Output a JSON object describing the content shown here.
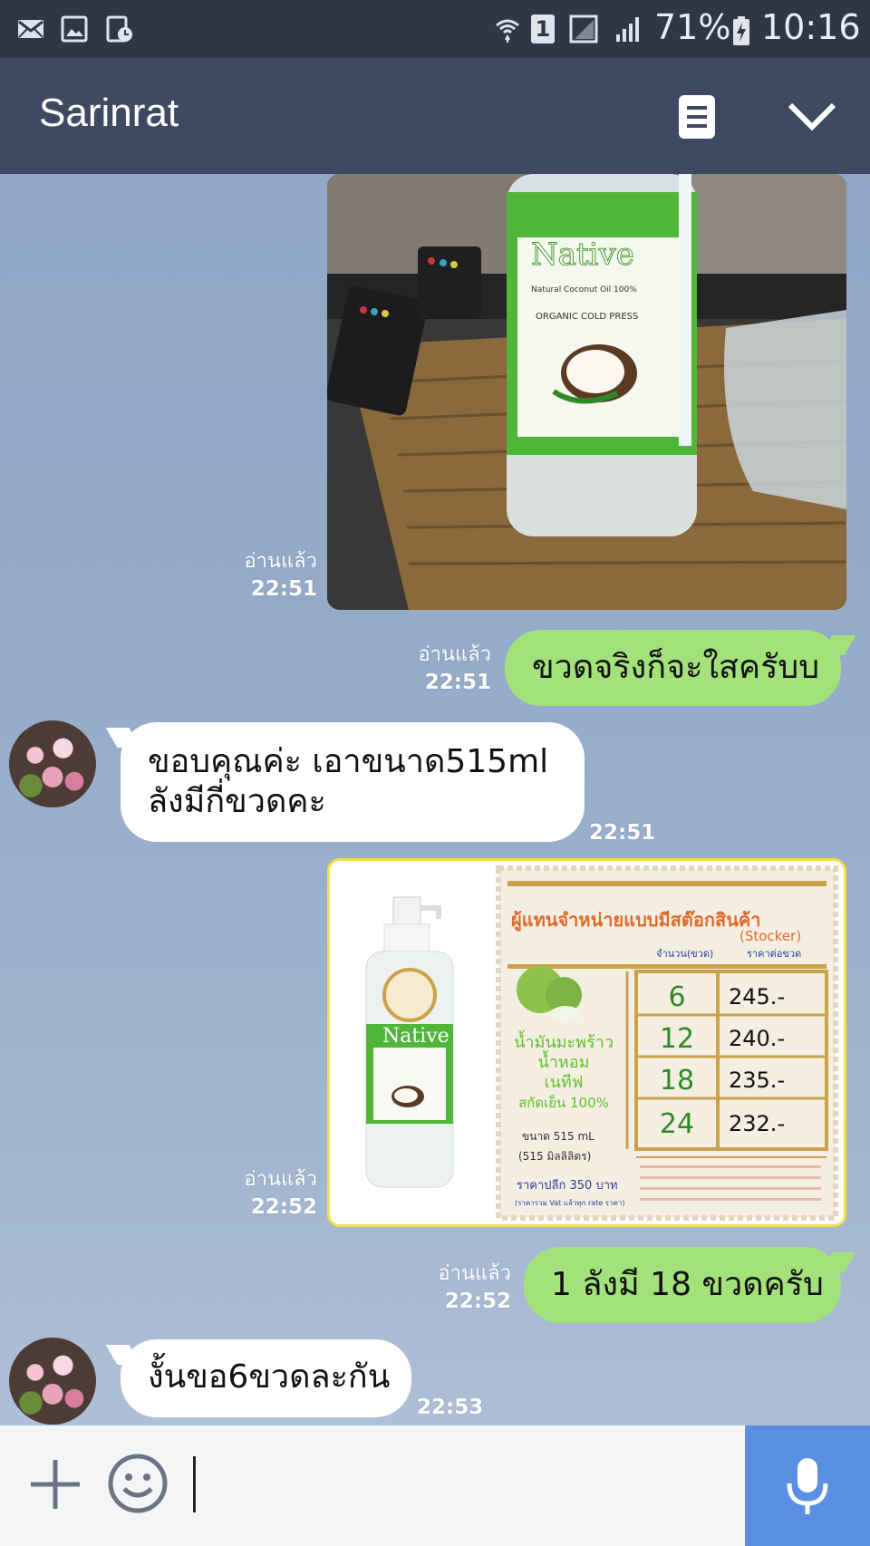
{
  "status_bar": {
    "battery": "71%",
    "signal_badge": "1",
    "time": "10:16"
  },
  "header": {
    "title": "Sarinrat"
  },
  "messages": [
    {
      "type": "image",
      "direction": "out",
      "read": "อ่านแล้ว",
      "time": "22:51",
      "content": {
        "brand": "Native",
        "label_line1": "Natural Coconut Oil 100%",
        "label_line2": "ORGANIC COLD PRESS"
      }
    },
    {
      "type": "text",
      "direction": "out",
      "read": "อ่านแล้ว",
      "time": "22:51",
      "text": "ขวดจริงก็จะใสครับบ"
    },
    {
      "type": "text",
      "direction": "in",
      "time": "22:51",
      "line1": "ขอบคุณค่ะ เอาขนาด515ml",
      "line2": "ลังมีกี่ขวดคะ"
    },
    {
      "type": "image",
      "direction": "out",
      "read": "อ่านแล้ว",
      "time": "22:52",
      "content": {
        "brand": "Native",
        "heading": "ผู้แทนจำหน่ายแบบมีสต๊อกสินค้า",
        "subheading": "(Stocker)",
        "col_qty": "จำนวน(ขวด)",
        "col_price": "ราคาต่อขวด",
        "rows": [
          {
            "qty": "6",
            "price": "245.-"
          },
          {
            "qty": "12",
            "price": "240.-"
          },
          {
            "qty": "18",
            "price": "235.-"
          },
          {
            "qty": "24",
            "price": "232.-"
          }
        ],
        "product_line1": "น้ำมันมะพร้าว",
        "product_line2": "น้ำหอม",
        "product_line3": "เนทีฟ",
        "product_line4": "สกัดเย็น 100%",
        "size_line1": "ขนาด 515 mL",
        "size_line2": "(515 มิลลิลิตร)",
        "retail": "ราคาปลีก 350 บาท",
        "retail_note": "(ราคารวม Vat แล้วทุก rate ราคา)"
      }
    },
    {
      "type": "text",
      "direction": "out",
      "read": "อ่านแล้ว",
      "time": "22:52",
      "text": "1 ลังมี 18 ขวดครับ"
    },
    {
      "type": "text",
      "direction": "in",
      "time": "22:53",
      "text": "งั้นขอ6ขวดละกัน"
    }
  ],
  "colors": {
    "header_bg": "#3f4a62",
    "status_bg": "#2f3747",
    "outgoing_bubble": "#a3e27a",
    "incoming_bubble": "#ffffff",
    "mic_button": "#5b8fe4"
  }
}
